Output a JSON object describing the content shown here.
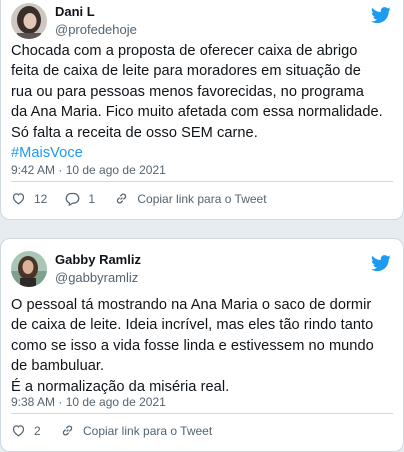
{
  "colors": {
    "accent": "#1d9bf0",
    "text": "#0f1419",
    "muted": "#536471",
    "border": "#cfd9de"
  },
  "tweets": [
    {
      "author": {
        "name": "Dani L",
        "handle": "@profedehoje"
      },
      "text_lines": [
        "Chocada com a proposta de oferecer caixa de abrigo",
        "feita de caixa de leite para moradores em situação de",
        "rua ou para pessoas menos favorecidas, no programa",
        "da Ana Maria. Fico muito afetada com essa normalidade.",
        "Só falta a receita de osso SEM carne."
      ],
      "hashtag": "#MaisVoce",
      "timestamp": "9:42 AM · 10 de ago de 2021",
      "likes": "12",
      "replies": "1",
      "copy_link_label": "Copiar link para o Tweet",
      "icons": {
        "brand": "twitter-bird-icon",
        "like": "heart-icon",
        "reply": "reply-icon",
        "link": "link-icon"
      }
    },
    {
      "author": {
        "name": "Gabby Ramliz",
        "handle": "@gabbyramliz"
      },
      "text_lines": [
        "O pessoal tá mostrando na Ana Maria o saco de dormir",
        "de caixa de leite. Ideia incrível, mas eles tão rindo tanto",
        "como se isso a vida fosse linda e estivessem no mundo",
        "de bambuluar.",
        "É a normalização da miséria real."
      ],
      "timestamp": "9:38 AM · 10 de ago de 2021",
      "likes": "2",
      "copy_link_label": "Copiar link para o Tweet",
      "icons": {
        "brand": "twitter-bird-icon",
        "like": "heart-icon",
        "link": "link-icon"
      }
    }
  ]
}
